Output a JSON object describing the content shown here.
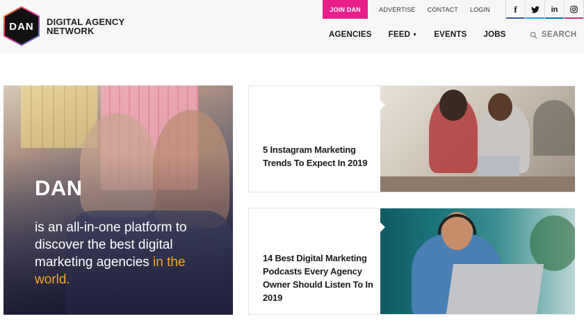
{
  "brand": {
    "logo_letters": "DAN",
    "name_line1": "DIGITAL AGENCY",
    "name_line2": "NETWORK"
  },
  "topbar": {
    "join_label": "JOIN DAN",
    "links": [
      "ADVERTISE",
      "CONTACT",
      "LOGIN"
    ],
    "socials": [
      {
        "icon": "facebook-icon",
        "glyph": "f",
        "color": "#3b5998"
      },
      {
        "icon": "twitter-icon",
        "glyph": "t",
        "color": "#1da1f2"
      },
      {
        "icon": "linkedin-icon",
        "glyph": "in",
        "color": "#0077b5"
      },
      {
        "icon": "instagram-icon",
        "glyph": "ig",
        "color": "#c13584"
      }
    ]
  },
  "nav": {
    "items": [
      "AGENCIES",
      "FEED",
      "EVENTS",
      "JOBS"
    ],
    "search_label": "SEARCH"
  },
  "hero": {
    "title": "DAN",
    "subtitle": "is an all-in-one platform to discover the best digital marketing agencies",
    "accent": "in the world."
  },
  "cards": [
    {
      "title": "5 Instagram Marketing Trends To Expect In 2019"
    },
    {
      "title": "14 Best Digital Marketing Podcasts Every Agency Owner Should Listen To In 2019"
    }
  ],
  "colors": {
    "join_bg": "#e91e8c",
    "accent": "#f5a623"
  }
}
